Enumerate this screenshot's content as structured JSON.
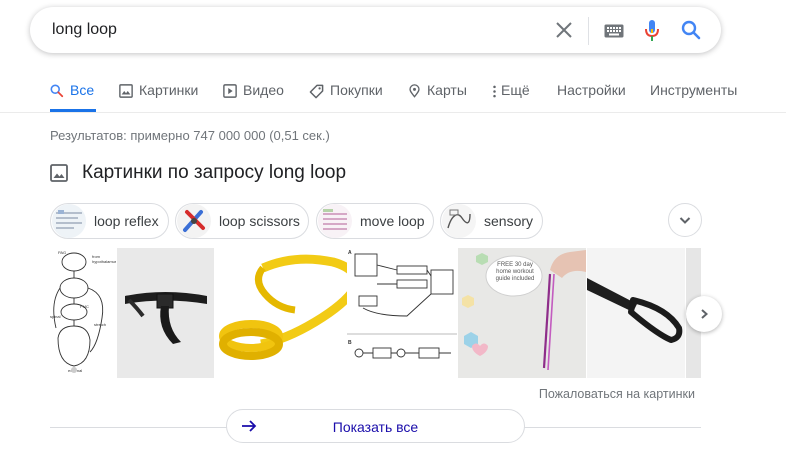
{
  "search": {
    "query": "long loop"
  },
  "tabs": [
    {
      "label": "Все",
      "icon": "search-icon"
    },
    {
      "label": "Картинки",
      "icon": "image-icon"
    },
    {
      "label": "Видео",
      "icon": "video-icon"
    },
    {
      "label": "Покупки",
      "icon": "tag-icon"
    },
    {
      "label": "Карты",
      "icon": "map-pin-icon"
    },
    {
      "label": "Ещё",
      "icon": "more-vert-icon"
    },
    {
      "label": "Настройки"
    },
    {
      "label": "Инструменты"
    }
  ],
  "results_count": "Результатов: примерно 747 000 000 (0,51 сек.)",
  "images_section": {
    "title": "Картинки по запросу long loop",
    "chips": [
      "loop reflex",
      "loop scissors",
      "move loop",
      "sensory"
    ],
    "images": [
      {
        "description": "diagram-reflex",
        "icon": "diagram-image"
      },
      {
        "description": "black-belt",
        "icon": "photo-image"
      },
      {
        "description": "yellow-loop-band",
        "icon": "photo-image"
      },
      {
        "description": "block-diagram",
        "icon": "diagram-image"
      },
      {
        "description": "band-on-wall",
        "icon": "photo-image",
        "text": "FREE 30 day home workout guide included"
      },
      {
        "description": "black-strap",
        "icon": "photo-image"
      }
    ],
    "feedback": "Пожаловаться на картинки",
    "show_all": "Показать все"
  },
  "colors": {
    "accent": "#1a73e8",
    "link": "#1a0dab",
    "muted": "#70757a"
  }
}
